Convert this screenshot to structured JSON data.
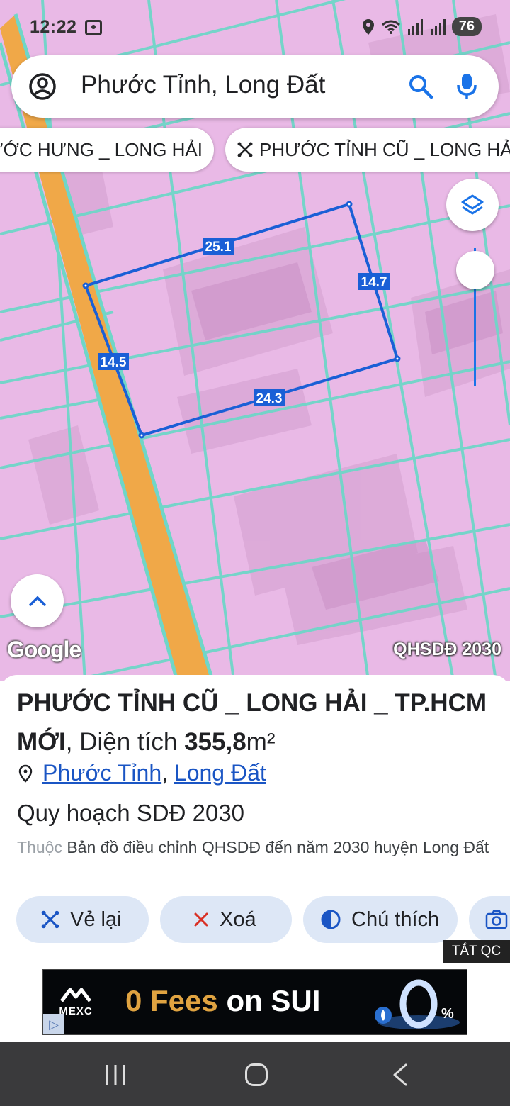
{
  "status_bar": {
    "time": "12:22",
    "battery": "76",
    "icons": [
      "screen-record-icon",
      "location-icon",
      "wifi-icon",
      "signal-icon",
      "signal-icon"
    ]
  },
  "search": {
    "query": "Phước Tỉnh, Long Đất",
    "icons": [
      "account-icon",
      "search-icon",
      "mic-icon"
    ]
  },
  "chips": [
    {
      "label": "ƯỚC HƯNG _ LONG HẢI"
    },
    {
      "label": "PHƯỚC TỈNH CŨ _ LONG HẢ",
      "icon": "draw-polygon-icon"
    }
  ],
  "map": {
    "measurements": {
      "top": "25.1",
      "right": "14.7",
      "left": "14.5",
      "bottom": "24.3"
    },
    "google_logo": "Google",
    "layer_label": "QHSDĐ 2030",
    "zoom_level": 0.16
  },
  "sheet": {
    "title_bold": "PHƯỚC TỈNH CŨ _ LONG HẢI _ TP.HCM MỚI",
    "title_sep": ",",
    "area_label": "Diện tích",
    "area_value": "355,8",
    "area_unit": "m²",
    "location_1": "Phước Tỉnh",
    "location_sep": ",",
    "location_2": "Long Đất",
    "plan_title": "Quy hoạch SDĐ 2030",
    "plan_desc_prefix": "Thuộc",
    "plan_desc": "Bản đồ điều chỉnh QHSDĐ đến năm 2030 huyện Long Đất"
  },
  "actions": [
    {
      "label": "Vẻ lại",
      "icon": "draw-polygon-icon"
    },
    {
      "label": "Xoá",
      "icon": "close-icon"
    },
    {
      "label": "Chú thích",
      "icon": "contrast-icon"
    },
    {
      "label": "",
      "icon": "camera-icon"
    }
  ],
  "ads": {
    "ads_off_label": "TẮT QC",
    "brand": "MEXC",
    "headline_accent": "0 Fees",
    "headline_rest": "on SUI"
  },
  "colors": {
    "map_background": "#e9b9e6",
    "road": "#f0a848",
    "parcel_border": "#6fd6c8",
    "measure_line": "#1a5fd6",
    "accent": "#1a73e8",
    "delete_red": "#d93025"
  }
}
